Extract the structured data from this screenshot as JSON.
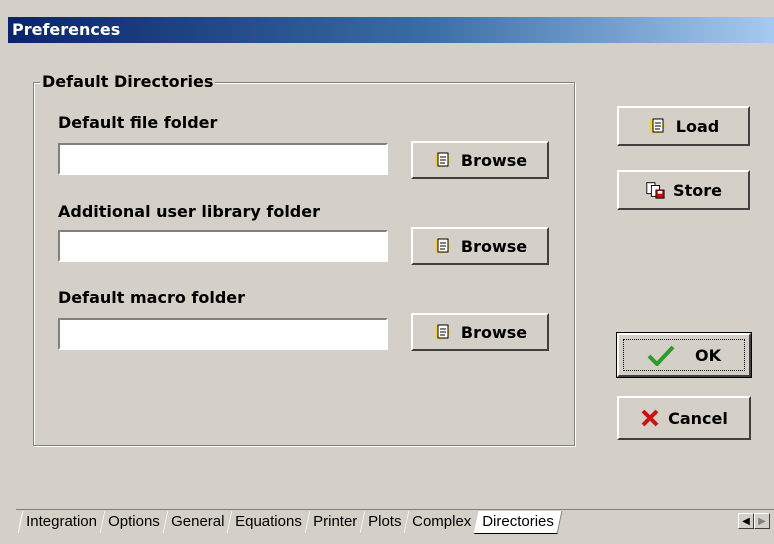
{
  "window": {
    "title": "Preferences"
  },
  "group": {
    "title": "Default Directories",
    "fields": [
      {
        "label": "Default file folder",
        "value": "",
        "button": "Browse"
      },
      {
        "label": "Additional user library folder",
        "value": "",
        "button": "Browse"
      },
      {
        "label": "Default macro folder",
        "value": "",
        "button": "Browse"
      }
    ]
  },
  "buttons": {
    "load": "Load",
    "store": "Store",
    "ok": "OK",
    "cancel": "Cancel"
  },
  "tabs": [
    "Integration",
    "Options",
    "General",
    "Equations",
    "Printer",
    "Plots",
    "Complex",
    "Directories"
  ],
  "active_tab": "Directories",
  "colors": {
    "titlebar_start": "#0a246a",
    "titlebar_end": "#a6caf0",
    "face": "#d4d0c8",
    "ok_check": "#2e9b2e",
    "cancel_x": "#cc1111"
  }
}
